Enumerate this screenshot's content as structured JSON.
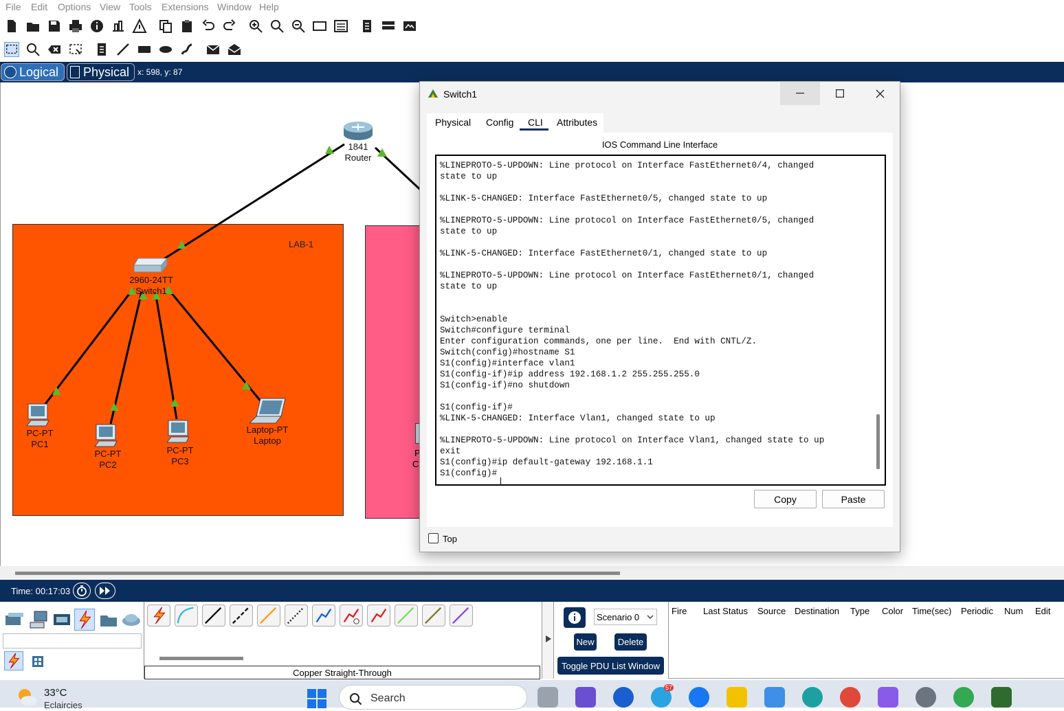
{
  "menu": [
    "File",
    "Edit",
    "Options",
    "View",
    "Tools",
    "Extensions",
    "Window",
    "Help"
  ],
  "viewbar": {
    "logical_label": "Logical",
    "physical_label": "Physical",
    "coords": "x: 598, y: 87"
  },
  "topology": {
    "router": {
      "model": "1841",
      "name": "Router"
    },
    "lab1_label": "LAB-1",
    "switch": {
      "model": "2960-24TT",
      "name": "Switch1"
    },
    "pc1": {
      "model": "PC-PT",
      "name": "PC1"
    },
    "pc2": {
      "model": "PC-PT",
      "name": "PC2"
    },
    "pc3": {
      "model": "PC-PT",
      "name": "PC3"
    },
    "laptop": {
      "model": "Laptop-PT",
      "name": "Laptop"
    },
    "partial1": "P",
    "partial2": "C"
  },
  "dialog": {
    "title": "Switch1",
    "tabs": [
      "Physical",
      "Config",
      "CLI",
      "Attributes"
    ],
    "active_tab": "CLI",
    "header": "IOS Command Line Interface",
    "cli_output": "%LINEPROTO-5-UPDOWN: Line protocol on Interface FastEthernet0/4, changed\nstate to up\n\n%LINK-5-CHANGED: Interface FastEthernet0/5, changed state to up\n\n%LINEPROTO-5-UPDOWN: Line protocol on Interface FastEthernet0/5, changed\nstate to up\n\n%LINK-5-CHANGED: Interface FastEthernet0/1, changed state to up\n\n%LINEPROTO-5-UPDOWN: Line protocol on Interface FastEthernet0/1, changed\nstate to up\n\n\nSwitch>enable\nSwitch#configure terminal\nEnter configuration commands, one per line.  End with CNTL/Z.\nSwitch(config)#hostname S1\nS1(config)#interface vlan1\nS1(config-if)#ip address 192.168.1.2 255.255.255.0\nS1(config-if)#no shutdown\n\nS1(config-if)#\n%LINK-5-CHANGED: Interface Vlan1, changed state to up\n\n%LINEPROTO-5-UPDOWN: Line protocol on Interface Vlan1, changed state to up\nexit\nS1(config)#ip default-gateway 192.168.1.1\nS1(config)#",
    "copy_label": "Copy",
    "paste_label": "Paste",
    "top_label": "Top"
  },
  "timebar": {
    "time": "Time: 00:17:03"
  },
  "bottom": {
    "cable_name": "Copper Straight-Through",
    "scenario": "Scenario 0",
    "new_label": "New",
    "delete_label": "Delete",
    "toggle_label": "Toggle PDU List Window",
    "pdu_columns": [
      "Fire",
      "Last Status",
      "Source",
      "Destination",
      "Type",
      "Color",
      "Time(sec)",
      "Periodic",
      "Num",
      "Edit"
    ]
  },
  "taskbar": {
    "temp": "33°C",
    "weather": "Eclaircies",
    "search": "Search",
    "telegram_badge": "57"
  },
  "colors": {
    "nav_bar": "#0b2d5b",
    "lab1_fill": "#ff5500",
    "lab2_fill": "#ff5c86",
    "link_green": "#5cb82e"
  }
}
